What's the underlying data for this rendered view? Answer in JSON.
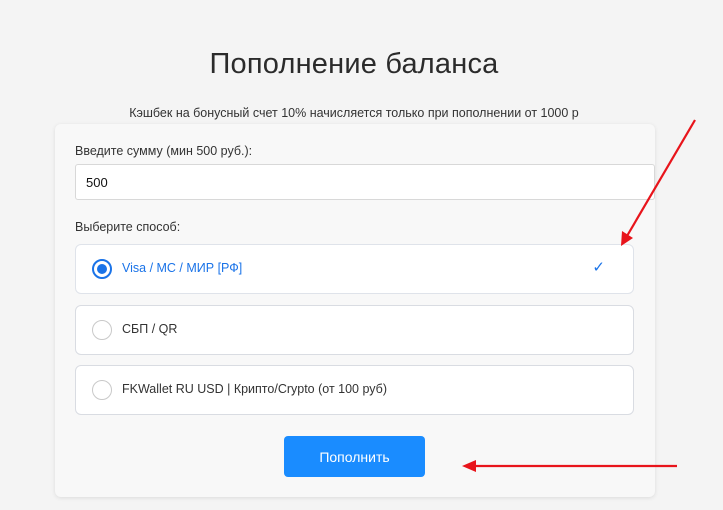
{
  "title": "Пополнение баланса",
  "cashback_note": "Кэшбек на бонусный счет 10% начисляется только при пополнении от 1000 р",
  "form": {
    "amount_label": "Введите сумму (мин 500 руб.):",
    "amount_value": "500",
    "method_label": "Выберите способ:",
    "options": [
      {
        "label": "Visa / MC / МИР [РФ]",
        "selected": true,
        "check": "✓"
      },
      {
        "label": "СБП / QR",
        "selected": false
      },
      {
        "label": "FKWallet RU USD | Крипто/Crypto (от 100 руб)",
        "selected": false
      }
    ],
    "submit_label": "Пополнить"
  },
  "colors": {
    "accent": "#1a73e8",
    "button": "#1a8cff",
    "annotation_arrow": "#e8141b"
  }
}
